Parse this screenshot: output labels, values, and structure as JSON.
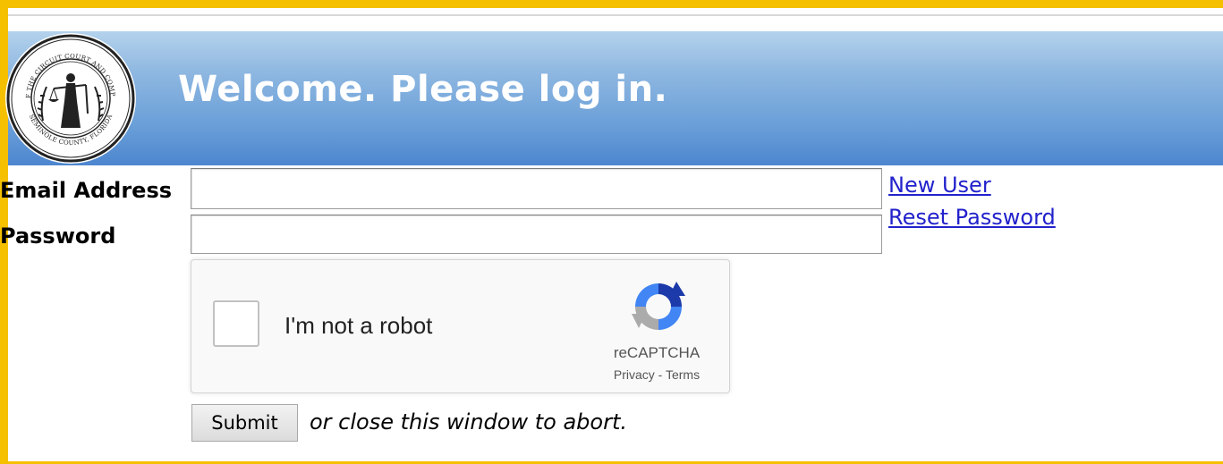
{
  "header": {
    "title": "Welcome. Please log in.",
    "seal": {
      "top_text": "CLERK OF THE CIRCUIT COURT AND COMPTROLLER",
      "bottom_text": "SEMINOLE COUNTY, FLORIDA"
    }
  },
  "form": {
    "email_label": "Email Address",
    "email_value": "",
    "password_label": "Password",
    "password_value": "",
    "new_user_link": "New User",
    "reset_password_link": "Reset Password",
    "submit_label": "Submit",
    "abort_text": "or close this window to abort."
  },
  "recaptcha": {
    "label": "I'm not a robot",
    "brand": "reCAPTCHA",
    "privacy": "Privacy",
    "separator": " - ",
    "terms": "Terms",
    "checked": false
  },
  "colors": {
    "frame_accent": "#f5c000",
    "header_gradient_top": "#b4d2ec",
    "header_gradient_bottom": "#4d86cf",
    "link": "#2222cc"
  },
  "icons": {
    "seal": "county-seal-icon",
    "recaptcha": "recaptcha-logo-icon"
  }
}
